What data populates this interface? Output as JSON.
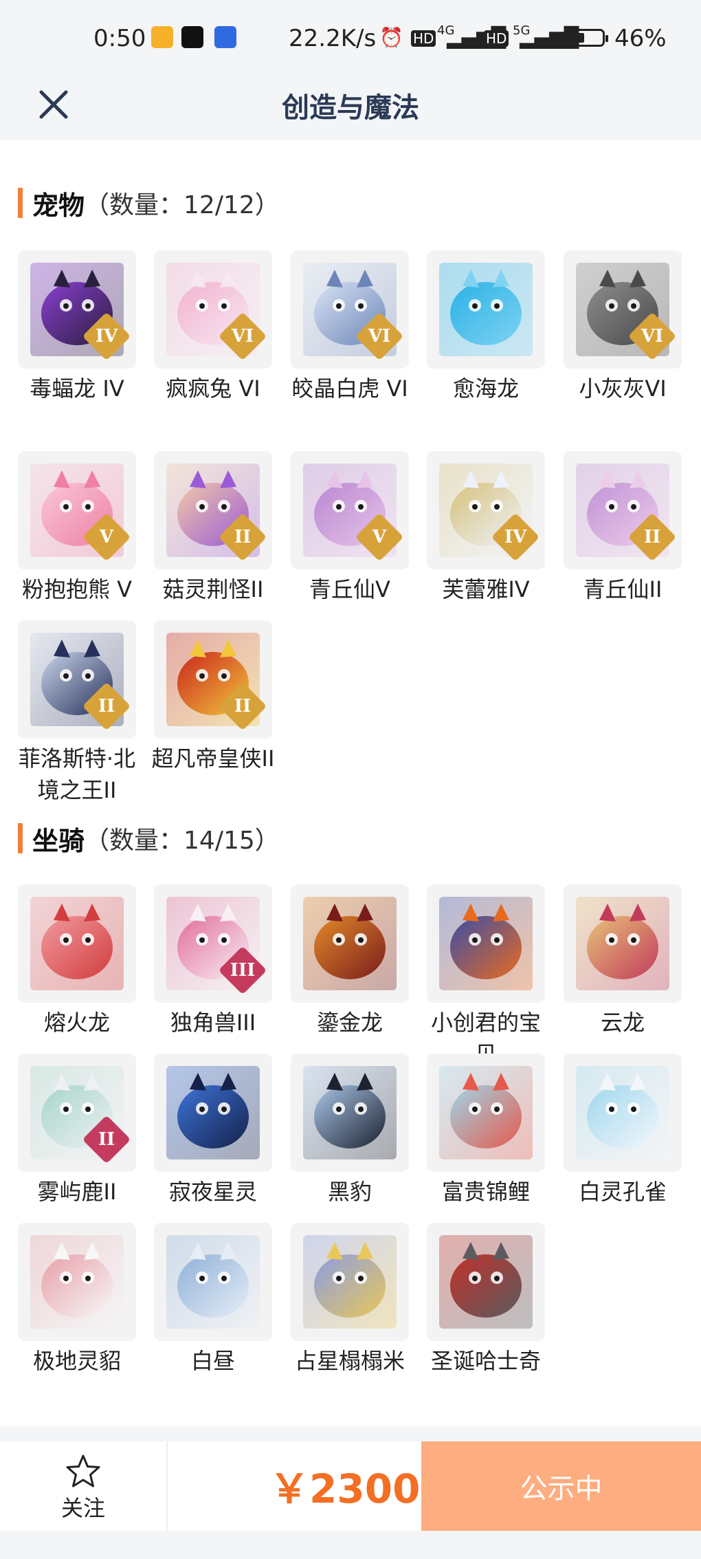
{
  "status": {
    "time": "0:50",
    "net_speed": "22.2K/s",
    "battery_pct": "46%",
    "battery_level": 0.46,
    "net1": "4G",
    "net2": "5G",
    "hd": "HD"
  },
  "header": {
    "title": "创造与魔法",
    "close_icon": "close-icon"
  },
  "pets": {
    "title": "宠物",
    "count": "（数量：12/12）",
    "items": [
      {
        "label": "毒蝠龙 IV",
        "badge": "IV",
        "colors": [
          "#2a1f3c",
          "#8a3fd1"
        ],
        "badge_color": "#d8a23b"
      },
      {
        "label": "疯疯兔 VI",
        "badge": "VI",
        "colors": [
          "#f6e7f2",
          "#f3b3cf"
        ],
        "badge_color": "#d8a23b"
      },
      {
        "label": "皎晶白虎 VI",
        "badge": "VI",
        "colors": [
          "#6d86b8",
          "#d8e3f4"
        ],
        "badge_color": "#d8a23b"
      },
      {
        "label": "愈海龙",
        "badge": "",
        "colors": [
          "#7fd2f2",
          "#2ab2e6"
        ],
        "badge_color": ""
      },
      {
        "label": "小灰灰VI",
        "badge": "VI",
        "colors": [
          "#4a4a4a",
          "#8d8d8d"
        ],
        "badge_color": "#d8a23b"
      },
      {
        "label": "粉抱抱熊 V",
        "badge": "V",
        "colors": [
          "#ef7fa6",
          "#f8c8d8"
        ],
        "badge_color": "#d8a23b"
      },
      {
        "label": "菇灵荆怪II",
        "badge": "II",
        "colors": [
          "#9a5bd8",
          "#f2c8a6"
        ],
        "badge_color": "#d8a23b"
      },
      {
        "label": "青丘仙V",
        "badge": "V",
        "colors": [
          "#e7c3e8",
          "#b988d2"
        ],
        "badge_color": "#d8a23b"
      },
      {
        "label": "芙蕾雅IV",
        "badge": "IV",
        "colors": [
          "#eef2fb",
          "#d6c27a"
        ],
        "badge_color": "#d8a23b"
      },
      {
        "label": "青丘仙II",
        "badge": "II",
        "colors": [
          "#eccce9",
          "#c293d6"
        ],
        "badge_color": "#d8a23b"
      },
      {
        "label": "菲洛斯特·北境之王II",
        "badge": "II",
        "colors": [
          "#26305a",
          "#c9d4ea"
        ],
        "badge_color": "#d8a23b"
      },
      {
        "label": "超凡帝皇侠II",
        "badge": "II",
        "colors": [
          "#f2c63b",
          "#c9251e"
        ],
        "badge_color": "#d8a23b"
      }
    ]
  },
  "mounts": {
    "title": "坐骑",
    "count": "（数量：14/15）",
    "items": [
      {
        "label": "熔火龙",
        "badge": "",
        "colors": [
          "#d23d3d",
          "#f09aa0"
        ],
        "badge_color": ""
      },
      {
        "label": "独角兽III",
        "badge": "III",
        "colors": [
          "#f8f0f4",
          "#e26d9c"
        ],
        "badge_color": "#c53b5e"
      },
      {
        "label": "鎏金龙",
        "badge": "",
        "colors": [
          "#7a1c1c",
          "#e28a2a"
        ],
        "badge_color": ""
      },
      {
        "label": "小创君的宝贝",
        "badge": "",
        "colors": [
          "#e86a1e",
          "#3b4fa8"
        ],
        "badge_color": ""
      },
      {
        "label": "云龙",
        "badge": "",
        "colors": [
          "#c23b5b",
          "#e7c27a"
        ],
        "badge_color": ""
      },
      {
        "label": "雾屿鹿II",
        "badge": "II",
        "colors": [
          "#eef0f4",
          "#a7d6c9"
        ],
        "badge_color": "#c53b5e"
      },
      {
        "label": "寂夜星灵",
        "badge": "",
        "colors": [
          "#15214a",
          "#3d74d8"
        ],
        "badge_color": ""
      },
      {
        "label": "黑豹",
        "badge": "",
        "colors": [
          "#1d2230",
          "#a9c6e8"
        ],
        "badge_color": ""
      },
      {
        "label": "富贵锦鲤",
        "badge": "",
        "colors": [
          "#e65a4c",
          "#9fd6e8"
        ],
        "badge_color": ""
      },
      {
        "label": "白灵孔雀",
        "badge": "",
        "colors": [
          "#f3f6fb",
          "#9fd8ec"
        ],
        "badge_color": ""
      },
      {
        "label": "极地灵貂",
        "badge": "",
        "colors": [
          "#f7f7f7",
          "#e6a0a8"
        ],
        "badge_color": ""
      },
      {
        "label": "白昼",
        "badge": "",
        "colors": [
          "#e6edf6",
          "#8fb1d8"
        ],
        "badge_color": ""
      },
      {
        "label": "占星榻榻米",
        "badge": "",
        "colors": [
          "#e9c85a",
          "#8c9de2"
        ],
        "badge_color": ""
      },
      {
        "label": "圣诞哈士奇",
        "badge": "",
        "colors": [
          "#5b5b60",
          "#c2322a"
        ],
        "badge_color": ""
      }
    ]
  },
  "bottom": {
    "follow_label": "关注",
    "follow_icon": "star-icon",
    "price": "￥2300",
    "cta_label": "公示中"
  }
}
